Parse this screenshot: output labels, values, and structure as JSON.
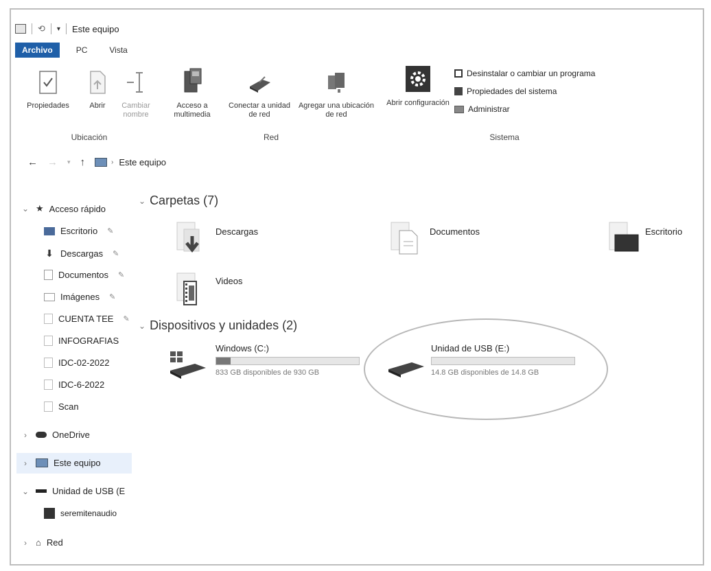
{
  "window": {
    "title": "Este equipo"
  },
  "ribbon": {
    "tabs": [
      {
        "label": "Archivo",
        "active": true
      },
      {
        "label": "PC",
        "active": false
      },
      {
        "label": "Vista",
        "active": false
      }
    ],
    "groups": {
      "ubicacion": {
        "label": "Ubicación",
        "buttons": [
          {
            "label": "Propiedades",
            "icon": "checklist-icon"
          },
          {
            "label": "Abrir",
            "icon": "open-file-icon"
          },
          {
            "label": "Cambiar nombre",
            "icon": "rename-icon"
          }
        ]
      },
      "red": {
        "label": "Red",
        "buttons": [
          {
            "label": "Acceso a multimedia",
            "icon": "media-server-icon"
          },
          {
            "label": "Conectar a unidad de red",
            "icon": "network-drive-icon"
          },
          {
            "label": "Agregar una ubicación de red",
            "icon": "network-location-icon"
          }
        ]
      },
      "sistema": {
        "label": "Sistema",
        "buttons": [
          {
            "label": "Abrir configuración",
            "icon": "settings-gear-icon"
          }
        ],
        "items": [
          {
            "label": "Desinstalar o cambiar un programa",
            "icon": "uninstall-icon"
          },
          {
            "label": "Propiedades del sistema",
            "icon": "system-properties-icon"
          },
          {
            "label": "Administrar",
            "icon": "manage-icon"
          }
        ]
      }
    }
  },
  "address": {
    "path": "Este equipo"
  },
  "nav": {
    "quick_access": "Acceso rápido",
    "items": [
      {
        "label": "Escritorio",
        "pinned": true,
        "icon": "desktop-folder-icon"
      },
      {
        "label": "Descargas",
        "pinned": true,
        "icon": "downloads-folder-icon"
      },
      {
        "label": "Documentos",
        "pinned": true,
        "icon": "documents-folder-icon"
      },
      {
        "label": "Imágenes",
        "pinned": true,
        "icon": "pictures-folder-icon"
      },
      {
        "label": "CUENTA TEE",
        "pinned": true,
        "icon": "folder-icon"
      },
      {
        "label": "INFOGRAFIAS",
        "pinned": false,
        "icon": "folder-icon"
      },
      {
        "label": "IDC-02-2022",
        "pinned": false,
        "icon": "folder-icon"
      },
      {
        "label": "IDC-6-2022",
        "pinned": false,
        "icon": "folder-icon"
      },
      {
        "label": "Scan",
        "pinned": false,
        "icon": "folder-icon"
      }
    ],
    "onedrive": "OneDrive",
    "this_pc": "Este equipo",
    "usb": "Unidad de USB (E",
    "usb_child": "seremitenaudio",
    "network": "Red"
  },
  "content": {
    "folders_header": "Carpetas (7)",
    "folders": [
      {
        "name": "Descargas",
        "icon": "downloads-folder-icon"
      },
      {
        "name": "Documentos",
        "icon": "documents-folder-icon"
      },
      {
        "name": "Escritorio",
        "icon": "desktop-folder-icon"
      },
      {
        "name": "Videos",
        "icon": "videos-folder-icon"
      }
    ],
    "devices_header": "Dispositivos y unidades (2)",
    "drives": [
      {
        "name": "Windows (C:)",
        "free": "833 GB disponibles de 930 GB",
        "used_fraction": 0.1,
        "icon": "windows-drive-icon"
      },
      {
        "name": "Unidad de USB (E:)",
        "free": "14.8 GB disponibles de 14.8 GB",
        "used_fraction": 0.0,
        "icon": "usb-drive-icon"
      }
    ]
  }
}
